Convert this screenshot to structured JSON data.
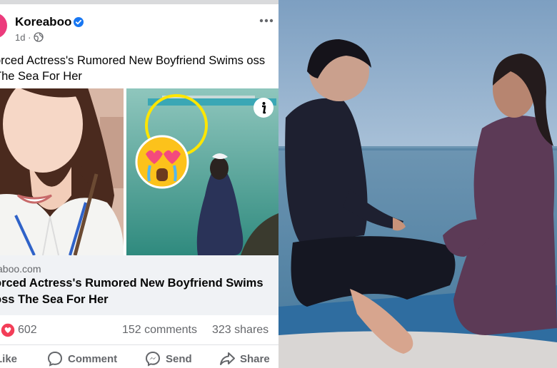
{
  "post": {
    "page_name": "Koreaboo",
    "time": "1d ·",
    "text": "orced Actress's Rumored New Boyfriend Swims oss The Sea For Her"
  },
  "link_preview": {
    "domain": "aboo.com",
    "title": "orced Actress's Rumored New Boyfriend Swims oss The Sea For Her"
  },
  "stats": {
    "reactions": "602",
    "comments": "152 comments",
    "shares": "323 shares"
  },
  "actions": {
    "like": "Like",
    "comment": "Comment",
    "send": "Send",
    "share": "Share"
  },
  "colors": {
    "brand_avatar": "#ec3b7c",
    "verified_blue": "#1877f2",
    "text_secondary": "#65676b",
    "love_red": "#f33e58"
  },
  "icons": [
    "verified-badge-icon",
    "globe-icon",
    "more-icon",
    "info-icon",
    "love-reaction-icon",
    "like-icon",
    "comment-icon",
    "messenger-icon",
    "share-icon"
  ]
}
